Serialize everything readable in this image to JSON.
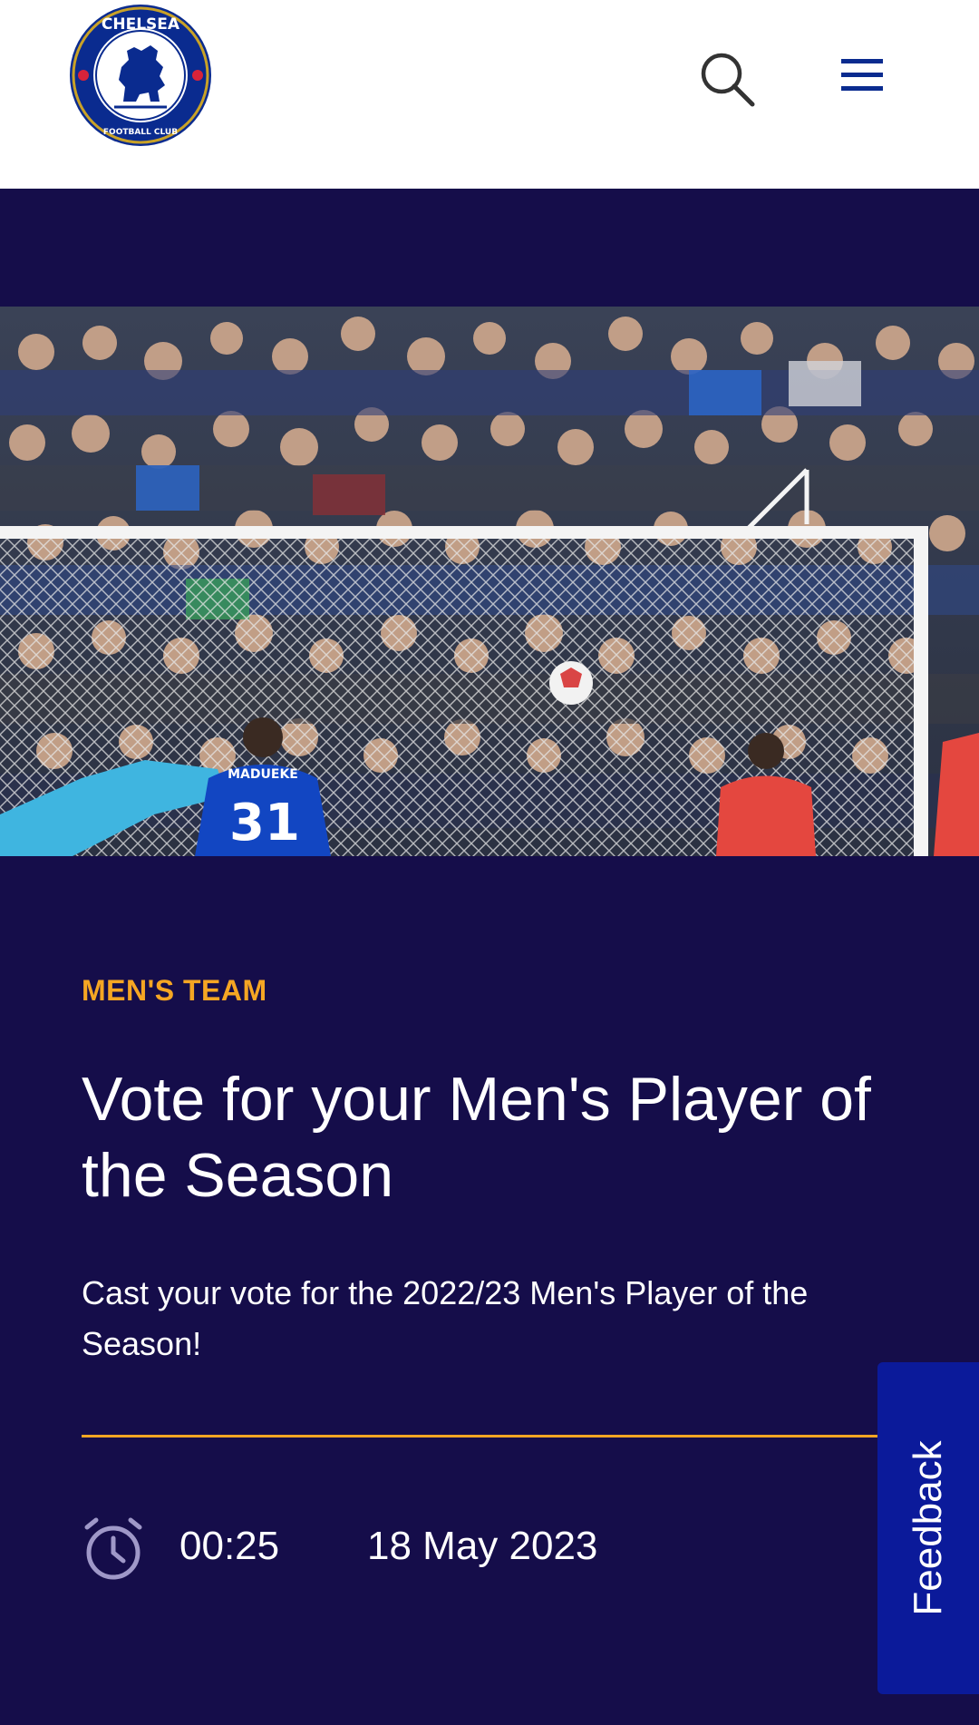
{
  "header": {
    "crest": {
      "icon": "chelsea-crest-icon",
      "text_top": "CHELSEA",
      "text_bottom": "FOOTBALL CLUB"
    },
    "search_icon": "search-icon",
    "menu_icon": "hamburger-menu-icon"
  },
  "hero": {
    "image": "Stadium crowd behind goal net, player number 31 in blue kit",
    "player_name": "MADUEKE",
    "player_number": "31"
  },
  "article": {
    "category": "MEN'S TEAM",
    "title": "Vote for your Men's Player of the Season",
    "summary": "Cast your vote for the 2022/23 Men's Player of the Season!",
    "clock_icon": "clock-icon",
    "duration": "00:25",
    "date": "18 May 2023"
  },
  "feedback": {
    "label": "Feedback"
  },
  "colors": {
    "background": "#150d4a",
    "accent": "#f5a623",
    "feedback": "#0b1a9a",
    "brand_blue": "#0a2b8f"
  }
}
